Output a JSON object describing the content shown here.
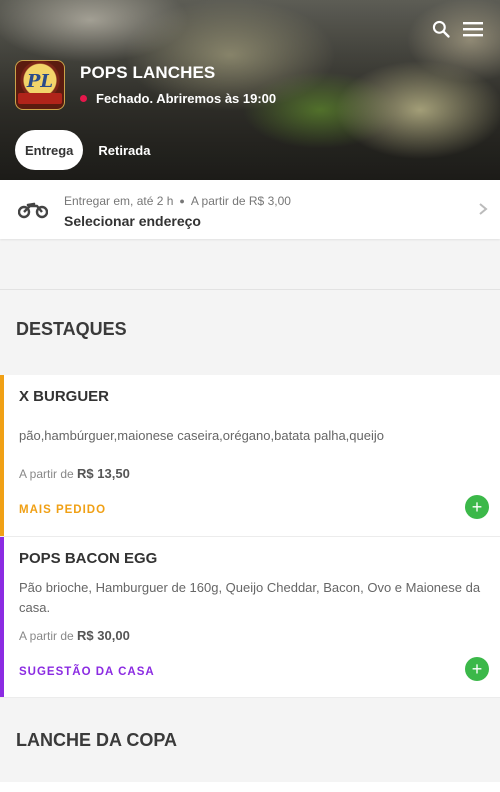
{
  "header": {
    "store_name": "POPS LANCHES",
    "status_text": "Fechado. Abriremos às 19:00",
    "status_color": "#e5174b",
    "logo_monogram": "PL",
    "logo_text": "Pops Lanches",
    "icons": {
      "search": "search-icon",
      "menu": "menu-icon"
    }
  },
  "tabs": [
    {
      "label": "Entrega",
      "active": true
    },
    {
      "label": "Retirada",
      "active": false
    }
  ],
  "delivery": {
    "line1_prefix": "Entregar em,",
    "eta": "até 2 h",
    "min_price": "A partir de R$ 3,00",
    "address_label": "Selecionar endereço",
    "icon": "motorcycle-icon"
  },
  "sections": [
    {
      "title": "DESTAQUES",
      "items": [
        {
          "name": "X BURGUER",
          "description": "pão,hambúrguer,maionese caseira,orégano,batata palha,queijo",
          "price_prefix": "A partir de",
          "price": "R$ 13,50",
          "tag": "MAIS PEDIDO",
          "accent": "#f0a015"
        },
        {
          "name": "POPS BACON EGG",
          "description": "Pão brioche, Hamburguer de 160g, Queijo Cheddar, Bacon, Ovo e Maionese da casa.",
          "price_prefix": "A partir de",
          "price": "R$ 30,00",
          "tag": "SUGESTÃO DA CASA",
          "accent": "#8b2be2"
        }
      ]
    },
    {
      "title": "LANCHE DA COPA",
      "items": []
    }
  ],
  "colors": {
    "add_button": "#3bb849"
  }
}
